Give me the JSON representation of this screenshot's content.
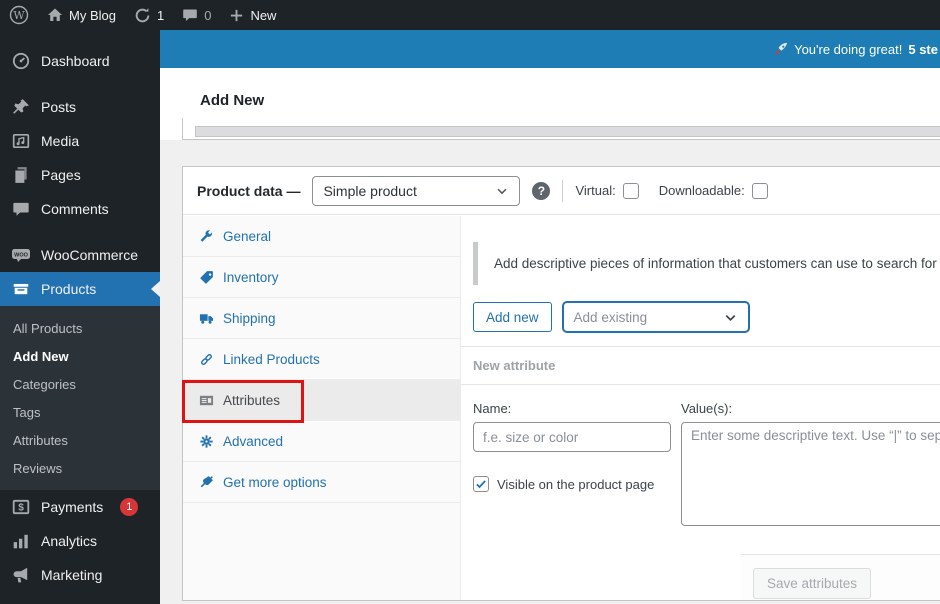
{
  "colors": {
    "accent_blue": "#2271b1",
    "banner_blue": "#1d7db4",
    "annotation_red": "#de1414",
    "badge_red": "#d63638",
    "sidebar_bg": "#1d2327",
    "submenu_bg": "#2c3338",
    "page_bg": "#f0f0f1"
  },
  "admin_bar": {
    "site_name": "My Blog",
    "updates_count": "1",
    "comments_count": "0",
    "new_label": "New"
  },
  "sidebar": {
    "top": [
      {
        "label": "Dashboard",
        "icon": "dashboard-icon"
      },
      {
        "label": "Posts",
        "icon": "pin-icon"
      },
      {
        "label": "Media",
        "icon": "media-icon"
      },
      {
        "label": "Pages",
        "icon": "pages-icon"
      },
      {
        "label": "Comments",
        "icon": "comments-icon"
      }
    ],
    "woocommerce": {
      "label": "WooCommerce",
      "icon": "woo-icon"
    },
    "products": {
      "label": "Products",
      "icon": "box-icon",
      "sub": [
        {
          "label": "All Products"
        },
        {
          "label": "Add New",
          "current": true
        },
        {
          "label": "Categories"
        },
        {
          "label": "Tags"
        },
        {
          "label": "Attributes"
        },
        {
          "label": "Reviews"
        }
      ]
    },
    "bottom": [
      {
        "label": "Payments",
        "icon": "payments-icon",
        "badge": "1"
      },
      {
        "label": "Analytics",
        "icon": "analytics-icon"
      },
      {
        "label": "Marketing",
        "icon": "megaphone-icon"
      }
    ]
  },
  "banner": {
    "message": "You're doing great!",
    "highlight": "5 ste"
  },
  "page": {
    "title": "Add New"
  },
  "product_data": {
    "header": {
      "title": "Product data —",
      "type_value": "Simple product",
      "help": "?",
      "virtual_label": "Virtual:",
      "downloadable_label": "Downloadable:"
    },
    "tabs": [
      {
        "label": "General",
        "icon": "wrench-icon"
      },
      {
        "label": "Inventory",
        "icon": "tag-icon"
      },
      {
        "label": "Shipping",
        "icon": "truck-icon"
      },
      {
        "label": "Linked Products",
        "icon": "link-icon"
      },
      {
        "label": "Attributes",
        "icon": "card-icon",
        "active": true
      },
      {
        "label": "Advanced",
        "icon": "gear-icon"
      },
      {
        "label": "Get more options",
        "icon": "plug-icon"
      }
    ],
    "attributes": {
      "note": "Add descriptive pieces of information that customers can use to search for this",
      "add_new_label": "Add new",
      "add_existing_placeholder": "Add existing",
      "section_title": "New attribute",
      "name_label": "Name:",
      "name_placeholder": "f.e. size or color",
      "values_label": "Value(s):",
      "values_placeholder": "Enter some descriptive text. Use “|” to sep",
      "visible_label": "Visible on the product page",
      "save_label": "Save attributes"
    }
  }
}
